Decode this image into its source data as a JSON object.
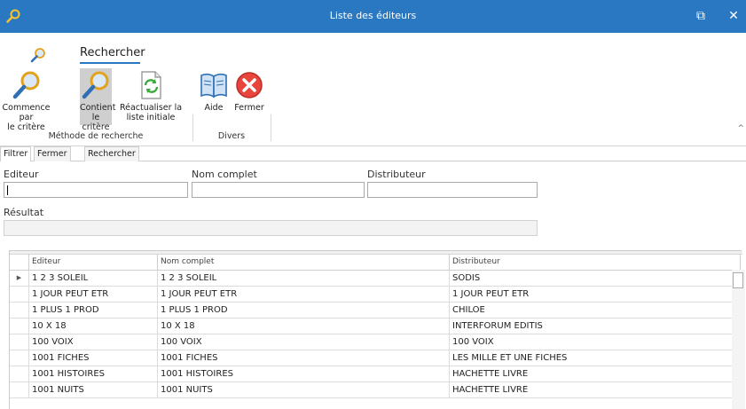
{
  "window": {
    "title": "Liste des éditeurs",
    "restore_glyph": "⧉",
    "close_glyph": "✕",
    "accent": "#2b78c2"
  },
  "ribbon": {
    "tab_label": "Rechercher",
    "groups": [
      {
        "label": "Méthode de recherche",
        "buttons": [
          {
            "label_line1": "Commence par",
            "label_line2": "le critère",
            "icon": "magnifier-icon"
          },
          {
            "label_line1": "Contient",
            "label_line2": "le critère",
            "icon": "magnifier-icon",
            "selected": true
          },
          {
            "label_line1": "Réactualiser la",
            "label_line2": "liste initiale",
            "icon": "refresh-document-icon"
          }
        ]
      },
      {
        "label": "Divers",
        "buttons": [
          {
            "label_line1": "Aide",
            "icon": "book-icon"
          },
          {
            "label_line1": "Fermer",
            "icon": "close-circle-icon"
          }
        ]
      }
    ],
    "collapse_glyph": "^"
  },
  "filter_tabs": [
    "Filtrer",
    "Fermer",
    "Rechercher"
  ],
  "filter": {
    "editeur_label": "Editeur",
    "editeur_value": "",
    "nom_complet_label": "Nom complet",
    "nom_complet_value": "",
    "distributeur_label": "Distributeur",
    "distributeur_value": "",
    "resultat_label": "Résultat",
    "resultat_value": ""
  },
  "grid": {
    "columns": [
      "Editeur",
      "Nom complet",
      "Distributeur"
    ],
    "current_row_glyph": "▶",
    "rows": [
      [
        "1 2 3 SOLEIL",
        "1 2 3 SOLEIL",
        "SODIS"
      ],
      [
        "1 JOUR PEUT ETR",
        "1 JOUR PEUT ETR",
        "1 JOUR PEUT ETR"
      ],
      [
        "1 PLUS 1 PROD",
        "1 PLUS 1 PROD",
        "CHILOE"
      ],
      [
        "10 X 18",
        "10 X 18",
        "INTERFORUM EDITIS"
      ],
      [
        "100 VOIX",
        "100 VOIX",
        "100 VOIX"
      ],
      [
        "1001 FICHES",
        "1001 FICHES",
        "LES MILLE ET UNE FICHES"
      ],
      [
        "1001 HISTOIRES",
        "1001 HISTOIRES",
        "HACHETTE LIVRE"
      ],
      [
        "1001 NUITS",
        "1001 NUITS",
        "HACHETTE LIVRE"
      ]
    ]
  }
}
